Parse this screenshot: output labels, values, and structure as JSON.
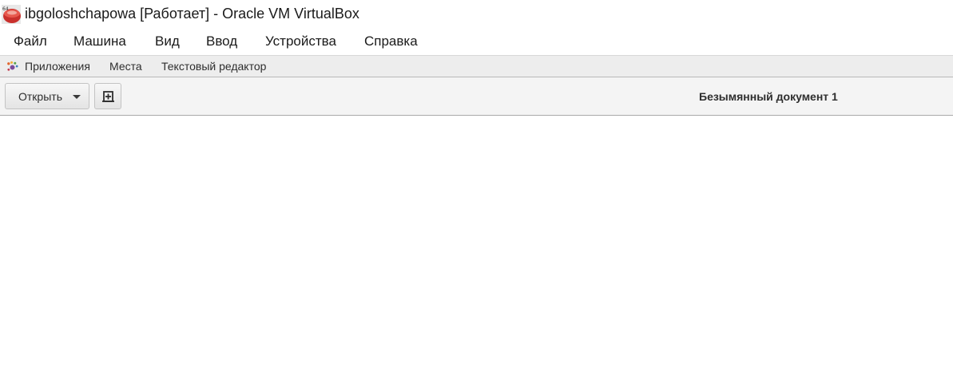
{
  "window": {
    "title": "ibgoloshchapowa [Работает] - Oracle VM VirtualBox",
    "icon": "virtualbox-icon",
    "icon_badge": "64"
  },
  "menubar": {
    "items": [
      {
        "label": "Файл"
      },
      {
        "label": "Машина"
      },
      {
        "label": "Вид"
      },
      {
        "label": "Ввод"
      },
      {
        "label": "Устройства"
      },
      {
        "label": "Справка"
      }
    ]
  },
  "gnome_panel": {
    "applications": "Приложения",
    "places": "Места",
    "active_app": "Текстовый редактор"
  },
  "headerbar": {
    "open_label": "Открыть",
    "new_tab_icon": "new-document-icon",
    "document_title": "Безымянный документ 1"
  },
  "editor": {
    "content": ""
  }
}
